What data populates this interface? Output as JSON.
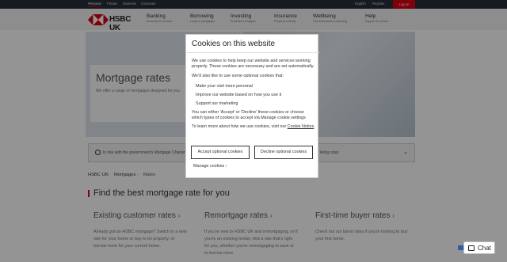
{
  "topbar": {
    "links": [
      "Personal",
      "Private",
      "Business",
      "Corporate"
    ],
    "right_links": [
      "English",
      "Register"
    ],
    "logon": "Log on"
  },
  "brand": {
    "name": "HSBC UK"
  },
  "nav": [
    {
      "title": "Banking",
      "sub": "Accounts & services"
    },
    {
      "title": "Borrowing",
      "sub": "Loans & mortgages"
    },
    {
      "title": "Investing",
      "sub": "Products & analysis"
    },
    {
      "title": "Insurance",
      "sub": "Property & family"
    },
    {
      "title": "Wellbeing",
      "sub": "Financial health & planning"
    },
    {
      "title": "Help",
      "sub": "Support & contact"
    }
  ],
  "hero": {
    "title": "Mortgage rates",
    "subtitle": "We offer a range of mortgages designed for you"
  },
  "infostrip": {
    "text": "In line with the government's Mortgage Charter, you may be able to move onto an interest-only payment through the cost of living crisis"
  },
  "breadcrumb": [
    "HSBC UK",
    "Mortgages",
    "Rates"
  ],
  "section_heading": "Find the best mortgage rate for you",
  "columns": [
    {
      "title": "Existing customer rates",
      "body": "Already got an HSBC mortgage? Switch to a new rate for your home or buy to let property, or borrow more for your current home."
    },
    {
      "title": "Remortgage rates",
      "body": "If you're new to HSBC UK and remortgaging, or if you're an existing lender, find a rate that's right for you, whether you're remortgaging to save or to borrow more."
    },
    {
      "title": "First-time buyer rates",
      "body": "Check out our latest rates if you're looking to buy your first home."
    }
  ],
  "modal": {
    "title": "Cookies on this website",
    "intro": "We use cookies to help keep our website and services working properly. These cookies are necessary and are set automatically.",
    "also_like": "We'd also like to use some optional cookies that:",
    "list": [
      "Make your visit more personal",
      "Improve our website based on how you use it",
      "Support our marketing"
    ],
    "choose": "You can either 'Accept' or 'Decline' these cookies or choose which types of cookies to accept via Manage cookie settings",
    "learn_prefix": "To learn more about how we use cookies, visit our",
    "learn_link": "Cookie Notice",
    "learn_suffix": ".",
    "accept": "Accept optional cookies",
    "decline": "Decline optional cookies",
    "manage": "Manage cookies"
  },
  "chat": {
    "label": "Chat"
  }
}
